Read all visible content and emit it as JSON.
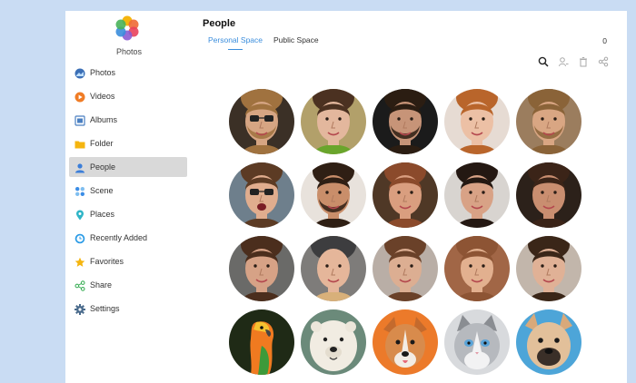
{
  "app": {
    "title": "Photos"
  },
  "sidebar": {
    "items": [
      {
        "label": "Photos",
        "icon": "photos-icon",
        "color": "#3b6fb6"
      },
      {
        "label": "Videos",
        "icon": "video-play-icon",
        "color": "#f07c25"
      },
      {
        "label": "Albums",
        "icon": "albums-icon",
        "color": "#4a7fc1"
      },
      {
        "label": "Folder",
        "icon": "folder-icon",
        "color": "#f5b50f"
      },
      {
        "label": "People",
        "icon": "person-icon",
        "color": "#3b7ed9",
        "active": true
      },
      {
        "label": "Scene",
        "icon": "scene-icon",
        "color": "#3b8de6"
      },
      {
        "label": "Places",
        "icon": "location-pin-icon",
        "color": "#2fb5c7"
      },
      {
        "label": "Recently Added",
        "icon": "clock-icon",
        "color": "#2b9be6"
      },
      {
        "label": "Favorites",
        "icon": "star-icon",
        "color": "#f5b50f"
      },
      {
        "label": "Share",
        "icon": "share-icon",
        "color": "#3fb05a"
      },
      {
        "label": "Settings",
        "icon": "gear-icon",
        "color": "#4a6b8c"
      }
    ]
  },
  "main": {
    "title": "People",
    "tabs": [
      {
        "label": "Personal Space",
        "active": true
      },
      {
        "label": "Public Space",
        "active": false
      }
    ],
    "count": "0",
    "toolbar": [
      "search-icon",
      "add-person-icon",
      "delete-icon",
      "share-icon"
    ]
  },
  "faces": [
    {
      "name": "man-glasses-beard",
      "bg": "#3b3026",
      "skin": "#d6a583",
      "hair": "#a0723f",
      "glasses": true,
      "beard": true
    },
    {
      "name": "woman-green-top",
      "bg": "#b2a06a",
      "skin": "#e3b79d",
      "hair": "#4b3121",
      "clothes": "#6aa52c"
    },
    {
      "name": "man-dark-bg",
      "bg": "#1b1b1b",
      "skin": "#c79478",
      "hair": "#2b1d12",
      "beard": true
    },
    {
      "name": "woman-red-hair",
      "bg": "#e6dbd3",
      "skin": "#ecc0a5",
      "hair": "#b9652b"
    },
    {
      "name": "man-smiling-beard",
      "bg": "#9b7d5e",
      "skin": "#d9a683",
      "hair": "#8a6338",
      "beard": true
    },
    {
      "name": "woman-sunglasses",
      "bg": "#6e7f8c",
      "skin": "#e0ad8e",
      "hair": "#5c3b24",
      "glasses": true,
      "mouth_open": true
    },
    {
      "name": "man-phone",
      "bg": "#e8e2dc",
      "skin": "#c98e6a",
      "hair": "#2f1f14",
      "beard": true
    },
    {
      "name": "woman-freckles",
      "bg": "#4f3826",
      "skin": "#d99e7f",
      "hair": "#8b4a2b"
    },
    {
      "name": "woman-dark-hair-smile",
      "bg": "#d8d4d0",
      "skin": "#d8a286",
      "hair": "#241812"
    },
    {
      "name": "woman-side-profile",
      "bg": "#2c211a",
      "skin": "#c98e70",
      "hair": "#3b2418"
    },
    {
      "name": "woman-brunette",
      "bg": "#6a6a68",
      "skin": "#d6a286",
      "hair": "#4b2e1d"
    },
    {
      "name": "woman-beanie",
      "bg": "#7e7c7a",
      "skin": "#e5b69a",
      "hair": "#d8b07a",
      "hat": "#3d3d3f"
    },
    {
      "name": "woman-long-hair",
      "bg": "#b9aea6",
      "skin": "#dcae92",
      "hair": "#6a4129"
    },
    {
      "name": "woman-bangs-red-lips",
      "bg": "#a16646",
      "skin": "#e2b08f",
      "hair": "#8d5434"
    },
    {
      "name": "man-smiling-young",
      "bg": "#c2b6ab",
      "skin": "#e0b196",
      "hair": "#3a2618"
    },
    {
      "name": "parrot",
      "bg": "#1f2a16",
      "kind": "bird"
    },
    {
      "name": "polar-bear",
      "bg": "#6b8a7a",
      "kind": "bear"
    },
    {
      "name": "corgi",
      "bg": "#ec7a2a",
      "kind": "dog-orange"
    },
    {
      "name": "cat",
      "bg": "#d8dadd",
      "kind": "cat"
    },
    {
      "name": "pug-dog",
      "bg": "#4da5d8",
      "kind": "dog-tan"
    }
  ]
}
